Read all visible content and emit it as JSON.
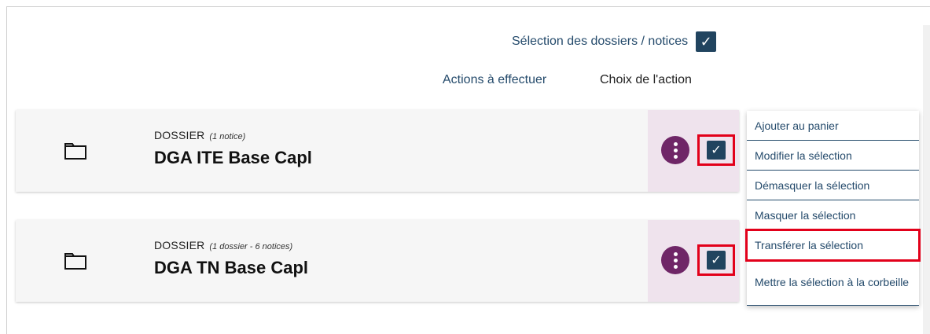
{
  "header": {
    "select_all_label": "Sélection des dossiers / notices",
    "select_all_checked": true,
    "actions_label": "Actions à effectuer",
    "choice_label": "Choix de l'action"
  },
  "records": [
    {
      "type": "DOSSIER",
      "count": "(1 notice)",
      "name": "DGA ITE Base Capl",
      "checked": true,
      "icon": "folder-icon"
    },
    {
      "type": "DOSSIER",
      "count": "(1 dossier - 6 notices)",
      "name": "DGA TN Base Capl",
      "checked": true,
      "icon": "folder-icon"
    }
  ],
  "action_menu": {
    "items": [
      {
        "label": "Ajouter au panier"
      },
      {
        "label": "Modifier la sélection"
      },
      {
        "label": "Démasquer la sélection"
      },
      {
        "label": "Masquer la sélection"
      },
      {
        "label": "Transférer la sélection",
        "highlighted": true
      },
      {
        "label": "Mettre la sélection à la corbeille"
      }
    ]
  },
  "colors": {
    "accent_dark_blue": "#21445f",
    "kebab_purple": "#6f2667",
    "highlight_red": "#e2001a"
  }
}
